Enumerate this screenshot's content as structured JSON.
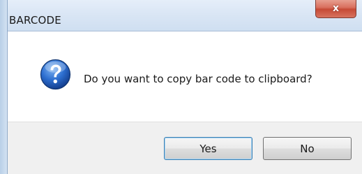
{
  "window": {
    "title": "BARCODE",
    "close_glyph": "x"
  },
  "message": {
    "icon": "question-icon",
    "text": "Do you want to copy bar code to clipboard?"
  },
  "buttons": {
    "yes_label": "Yes",
    "no_label": "No"
  },
  "colors": {
    "titlebar": "#dae6f5",
    "close_button": "#c64a36",
    "button_area": "#f0f0f0",
    "icon_blue": "#1f5fbf"
  }
}
